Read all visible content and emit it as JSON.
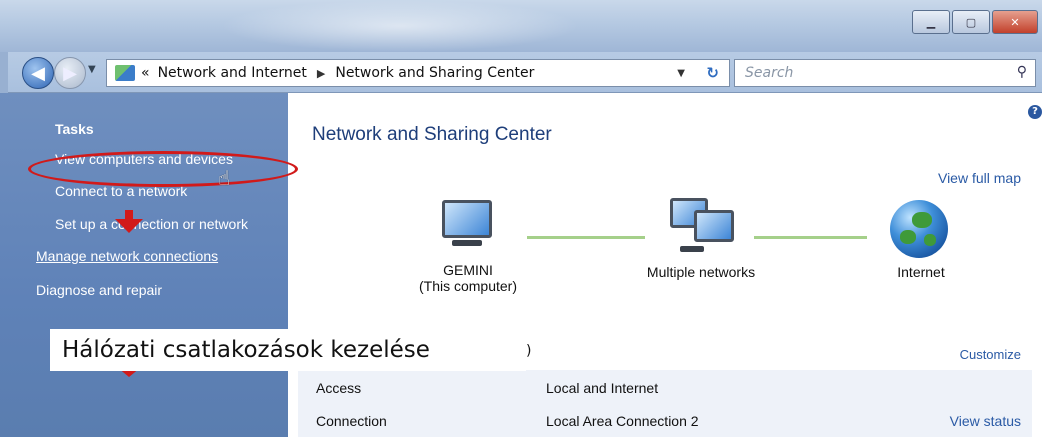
{
  "breadcrumb": {
    "overflow": "«",
    "segments": [
      "Network and Internet",
      "Network and Sharing Center"
    ]
  },
  "search": {
    "placeholder": "Search"
  },
  "left_pane": {
    "heading": "Tasks",
    "items": [
      "View computers and devices",
      "Connect to a network",
      "Set up a connection or network",
      "Manage network connections",
      "Diagnose and repair"
    ]
  },
  "main": {
    "title": "Network and Sharing Center",
    "view_full_map": "View full map",
    "map": {
      "computer_name": "GEMINI",
      "computer_sub": "(This computer)",
      "network_label": "Multiple networks",
      "internet_label": "Internet"
    },
    "section_tail": ")",
    "customize": "Customize",
    "rows": [
      {
        "label": "Access",
        "value": "Local and Internet",
        "action": ""
      },
      {
        "label": "Connection",
        "value": "Local Area Connection 2",
        "action": "View status"
      }
    ]
  },
  "overlay": {
    "caption": "Hálózati csatlakozások kezelése"
  },
  "colors": {
    "annotation_red": "#d11a1a",
    "left_pane_blue": "#5f82b8",
    "link_blue": "#2a5aa5",
    "map_link_green": "#a5d08a"
  },
  "icons": [
    "back-arrow-icon",
    "forward-arrow-icon",
    "control-panel-icon",
    "refresh-icon",
    "search-icon",
    "help-icon",
    "computer-icon",
    "multiple-networks-icon",
    "internet-globe-icon",
    "hand-cursor-icon"
  ]
}
